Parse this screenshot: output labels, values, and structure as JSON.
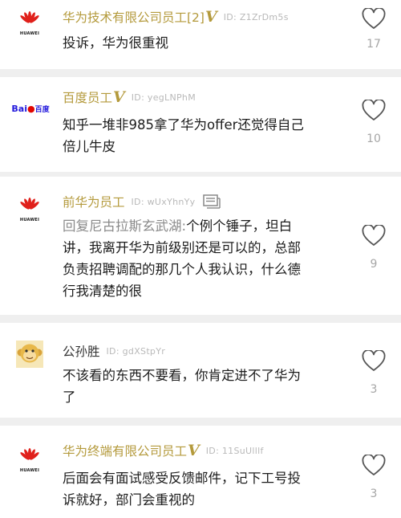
{
  "comments": [
    {
      "avatar": "huawei-logo",
      "avatar_text": "HUAWEI",
      "user": "华为技术有限公司员工[2]",
      "verified": "V",
      "id": "ID: Z1ZrDm5s",
      "lines": [
        "投诉，华为很重视"
      ],
      "likes": "17"
    },
    {
      "avatar": "baidu-logo",
      "avatar_text": "Bai百度",
      "user": "百度员工",
      "verified": "V",
      "id": "ID: yegLNPhM",
      "lines": [
        "知乎一堆非985拿了华为offer还觉得自己",
        "倍儿牛皮"
      ],
      "likes": "10"
    },
    {
      "avatar": "huawei-logo",
      "avatar_text": "HUAWEI",
      "user": "前华为员工",
      "verified": "",
      "id": "ID: wUxYhnYy",
      "reply_prefix": "回复尼古拉斯玄武湖:",
      "lines": [
        "个例个锤子，坦白",
        "讲，我离开华为前级别还是可以的，总部",
        "负责招聘调配的那几个人我认识，什么德",
        "行我清楚的很"
      ],
      "likes": "9"
    },
    {
      "avatar": "monkey-avatar",
      "avatar_text": "",
      "user": "公孙胜",
      "verified": "",
      "id": "ID: gdXStpYr",
      "lines": [
        "不该看的东西不要看，你肯定进不了华为",
        "了"
      ],
      "likes": "3"
    },
    {
      "avatar": "huawei-logo",
      "avatar_text": "HUAWEI",
      "user": "华为终端有限公司员工",
      "verified": "V",
      "id": "ID: 11SuUlllf",
      "lines": [
        "后面会有面试感受反馈邮件，记下工号投",
        "诉就好，部门会重视的"
      ],
      "likes": "3"
    }
  ],
  "colors": {
    "username": "#b49a3c",
    "huawei_red": "#e0201b",
    "baidu_blue": "#2319dc",
    "baidu_red": "#e10601"
  }
}
